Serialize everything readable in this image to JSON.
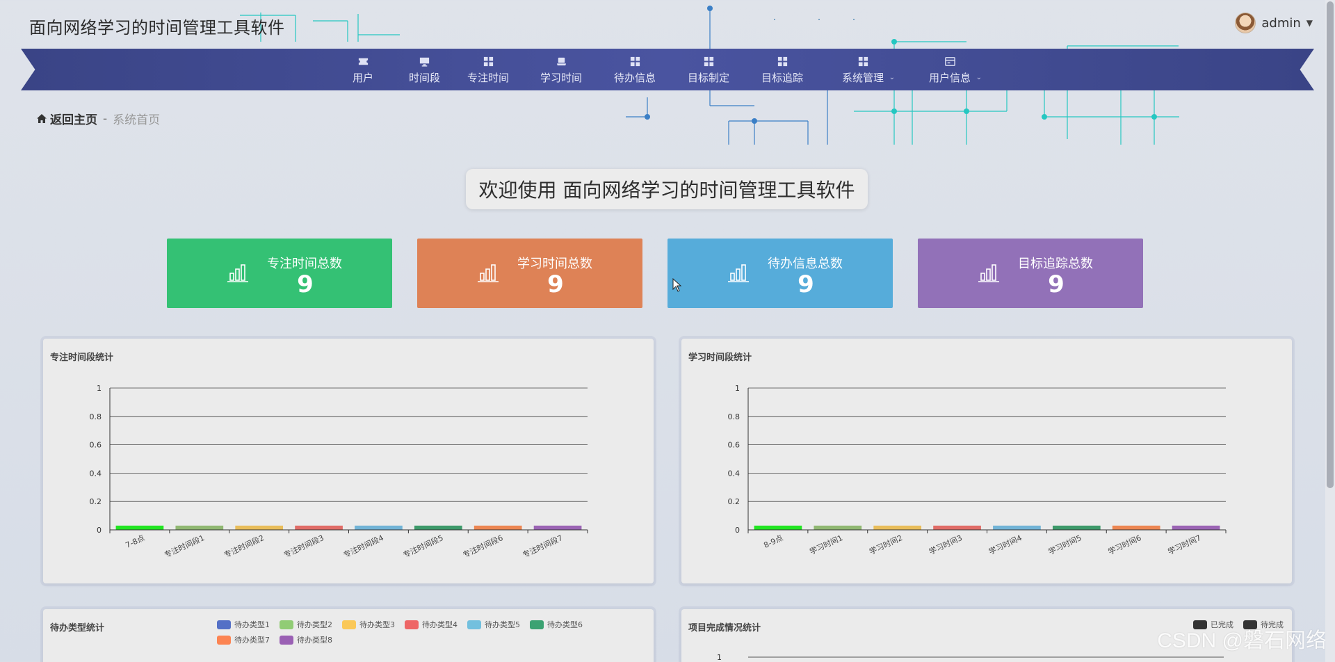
{
  "app": {
    "title": "面向网络学习的时间管理工具软件"
  },
  "user": {
    "name": "admin"
  },
  "nav": {
    "items": [
      {
        "label": "用户",
        "icon": "ticket-icon",
        "dropdown": false
      },
      {
        "label": "时间段",
        "icon": "monitor-icon",
        "dropdown": false
      },
      {
        "label": "专注时间",
        "icon": "grid-icon",
        "dropdown": false
      },
      {
        "label": "学习时间",
        "icon": "laptop-icon",
        "dropdown": false
      },
      {
        "label": "待办信息",
        "icon": "grid-icon",
        "dropdown": false
      },
      {
        "label": "目标制定",
        "icon": "grid-icon",
        "dropdown": false
      },
      {
        "label": "目标追踪",
        "icon": "grid-icon",
        "dropdown": false
      },
      {
        "label": "系统管理",
        "icon": "grid-icon",
        "dropdown": true
      },
      {
        "label": "用户信息",
        "icon": "card-icon",
        "dropdown": true
      }
    ]
  },
  "breadcrumb": {
    "home": "返回主页",
    "separator": "-",
    "current": "系统首页"
  },
  "welcome": "欢迎使用 面向网络学习的时间管理工具软件",
  "stats": [
    {
      "title": "专注时间总数",
      "value": "9",
      "color": "#34c174"
    },
    {
      "title": "学习时间总数",
      "value": "9",
      "color": "#de8256"
    },
    {
      "title": "待办信息总数",
      "value": "9",
      "color": "#56acda"
    },
    {
      "title": "目标追踪总数",
      "value": "9",
      "color": "#9271b8"
    }
  ],
  "panels": {
    "focus": {
      "title": "专注时间段统计"
    },
    "study": {
      "title": "学习时间段统计"
    },
    "todo": {
      "title": "待办类型统计"
    },
    "project": {
      "title": "项目完成情况统计"
    }
  },
  "colors": {
    "bars": [
      "#22e622",
      "#90b872",
      "#e8bd5a",
      "#e06c67",
      "#71b3d6",
      "#3d9a6a",
      "#ec8652",
      "#9b64b4"
    ],
    "legend": [
      "#5470c6",
      "#91cc75",
      "#fac858",
      "#ee6666",
      "#73c0de",
      "#3ba272",
      "#fc8452",
      "#9a60b4"
    ],
    "project_legend": [
      "#333333",
      "#333333"
    ]
  },
  "chart_data": [
    {
      "type": "bar",
      "categories": [
        "7-8点",
        "专注时间段1",
        "专注时间段2",
        "专注时间段3",
        "专注时间段4",
        "专注时间段5",
        "专注时间段6",
        "专注时间段7"
      ],
      "values": [
        0.03,
        0.03,
        0.03,
        0.03,
        0.03,
        0.03,
        0.03,
        0.03
      ],
      "ylim": [
        0,
        1
      ],
      "yticks": [
        "0",
        "0.2",
        "0.4",
        "0.6",
        "0.8",
        "1"
      ],
      "title": "专注时间段统计",
      "grid": true
    },
    {
      "type": "bar",
      "categories": [
        "8-9点",
        "学习时间1",
        "学习时间2",
        "学习时间3",
        "学习时间4",
        "学习时间5",
        "学习时间6",
        "学习时间7"
      ],
      "values": [
        0.03,
        0.03,
        0.03,
        0.03,
        0.03,
        0.03,
        0.03,
        0.03
      ],
      "ylim": [
        0,
        1
      ],
      "yticks": [
        "0",
        "0.2",
        "0.4",
        "0.6",
        "0.8",
        "1"
      ],
      "title": "学习时间段统计",
      "grid": true
    },
    {
      "type": "pie",
      "title": "待办类型统计",
      "legend": [
        "待办类型1",
        "待办类型2",
        "待办类型3",
        "待办类型4",
        "待办类型5",
        "待办类型6",
        "待办类型7",
        "待办类型8"
      ],
      "legend_position": "top"
    },
    {
      "type": "bar",
      "title": "项目完成情况统计",
      "legend": [
        "已完成",
        "待完成"
      ],
      "legend_position": "top-right",
      "yticks": [
        "1"
      ]
    }
  ],
  "watermark": "CSDN @磐石网络"
}
